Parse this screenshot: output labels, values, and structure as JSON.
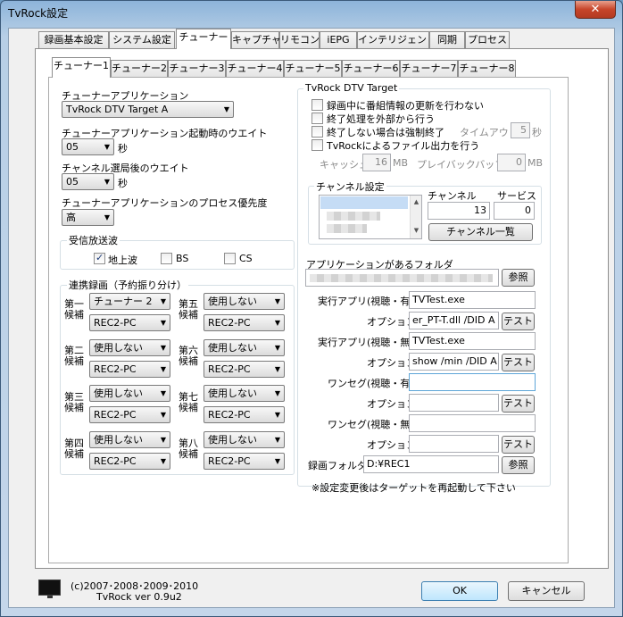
{
  "window": {
    "title": "TvRock設定",
    "close_label": "✕"
  },
  "main_tabs": [
    "録画基本設定",
    "システム設定",
    "チューナー",
    "キャプチャ",
    "リモコン",
    "iEPG",
    "インテリジェント",
    "同期",
    "プロセス"
  ],
  "tuner_tabs": [
    "チューナー1",
    "チューナー2",
    "チューナー3",
    "チューナー4",
    "チューナー5",
    "チューナー6",
    "チューナー7",
    "チューナー8"
  ],
  "tuner_app": {
    "label": "チューナーアプリケーション",
    "value": "TvRock DTV Target A"
  },
  "startup_wait": {
    "label": "チューナーアプリケーション起動時のウエイト",
    "value": "05",
    "unit": "秒"
  },
  "channel_wait": {
    "label": "チャンネル選局後のウエイト",
    "value": "05",
    "unit": "秒"
  },
  "priority": {
    "label": "チューナーアプリケーションのプロセス優先度",
    "value": "高"
  },
  "broadcast": {
    "title": "受信放送波",
    "terrestrial": "地上波",
    "bs": "BS",
    "cs": "CS"
  },
  "linked": {
    "title": "連携録画（予約振り分け）",
    "candidates": [
      {
        "label1": "第一",
        "label2": "候補",
        "tuner": "チューナー 2",
        "pc": "REC2-PC"
      },
      {
        "label1": "第二",
        "label2": "候補",
        "tuner": "使用しない",
        "pc": "REC2-PC"
      },
      {
        "label1": "第三",
        "label2": "候補",
        "tuner": "使用しない",
        "pc": "REC2-PC"
      },
      {
        "label1": "第四",
        "label2": "候補",
        "tuner": "使用しない",
        "pc": "REC2-PC"
      },
      {
        "label1": "第五",
        "label2": "候補",
        "tuner": "使用しない",
        "pc": "REC2-PC"
      },
      {
        "label1": "第六",
        "label2": "候補",
        "tuner": "使用しない",
        "pc": "REC2-PC"
      },
      {
        "label1": "第七",
        "label2": "候補",
        "tuner": "使用しない",
        "pc": "REC2-PC"
      },
      {
        "label1": "第八",
        "label2": "候補",
        "tuner": "使用しない",
        "pc": "REC2-PC"
      }
    ]
  },
  "dtv": {
    "title": "TvRock DTV Target",
    "opt1": "録画中に番組情報の更新を行わない",
    "opt2": "終了処理を外部から行う",
    "opt3": "終了しない場合は強制終了",
    "timeout_label": "タイムアウト",
    "timeout_value": "5",
    "timeout_unit": "秒",
    "opt4": "TvRockによるファイル出力を行う",
    "cache_label": "キャッシュ",
    "cache_value": "16",
    "cache_unit": "MB",
    "playback_label": "プレイバックバッファ",
    "playback_value": "0",
    "playback_unit": "MB"
  },
  "channel": {
    "title": "チャンネル設定",
    "channel_label": "チャンネル",
    "service_label": "サービス",
    "channel_value": "13",
    "service_value": "0",
    "list_button": "チャンネル一覧"
  },
  "app_folder": {
    "label": "アプリケーションがあるフォルダ",
    "browse": "参照"
  },
  "exec": [
    {
      "label": "実行アプリ(視聴・有)",
      "value": "TVTest.exe",
      "opt_label": "オプション",
      "opt_value": "er_PT-T.dll /DID A",
      "test": "テスト"
    },
    {
      "label": "実行アプリ(視聴・無)",
      "value": "TVTest.exe",
      "opt_label": "オプション",
      "opt_value": "show /min /DID A",
      "test": "テスト"
    },
    {
      "label": "ワンセグ(視聴・有)",
      "value": "",
      "opt_label": "オプション",
      "opt_value": "",
      "test": "テスト"
    },
    {
      "label": "ワンセグ(視聴・無)",
      "value": "",
      "opt_label": "オプション",
      "opt_value": "",
      "test": "テスト"
    }
  ],
  "rec_folder": {
    "label": "録画フォルダ",
    "value": "D:¥REC1",
    "browse": "参照"
  },
  "note": "※設定変更後はターゲットを再起動して下さい",
  "footer": {
    "copyright": "(c)2007･2008･2009･2010",
    "version": "TvRock ver 0.9u2",
    "ok": "OK",
    "cancel": "キャンセル"
  }
}
